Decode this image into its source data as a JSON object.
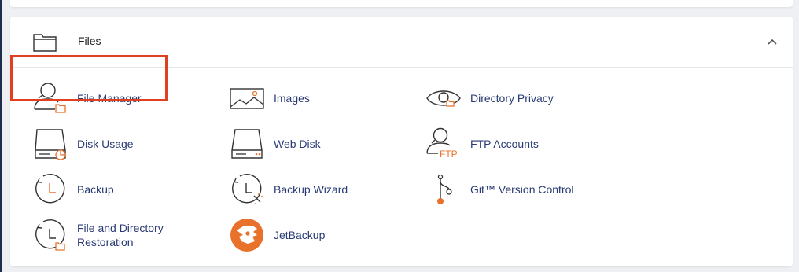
{
  "section": {
    "title": "Files",
    "items": [
      {
        "label": "File Manager",
        "icon": "file-manager-icon"
      },
      {
        "label": "Images",
        "icon": "images-icon"
      },
      {
        "label": "Directory Privacy",
        "icon": "eye-icon"
      },
      {
        "label": "Disk Usage",
        "icon": "disk-usage-icon"
      },
      {
        "label": "Web Disk",
        "icon": "web-disk-icon"
      },
      {
        "label": "FTP Accounts",
        "icon": "ftp-accounts-icon"
      },
      {
        "label": "Backup",
        "icon": "backup-icon"
      },
      {
        "label": "Backup Wizard",
        "icon": "backup-wizard-icon"
      },
      {
        "label": "Git™ Version Control",
        "icon": "git-icon"
      },
      {
        "label": "File and Directory\nRestoration",
        "icon": "file-restoration-icon"
      },
      {
        "label": "JetBackup",
        "icon": "jetbackup-icon"
      }
    ]
  },
  "colors": {
    "link": "#293a74",
    "accent": "#e8722c",
    "highlight_border": "#e0401f",
    "sidebar": "#1e2f4d"
  }
}
